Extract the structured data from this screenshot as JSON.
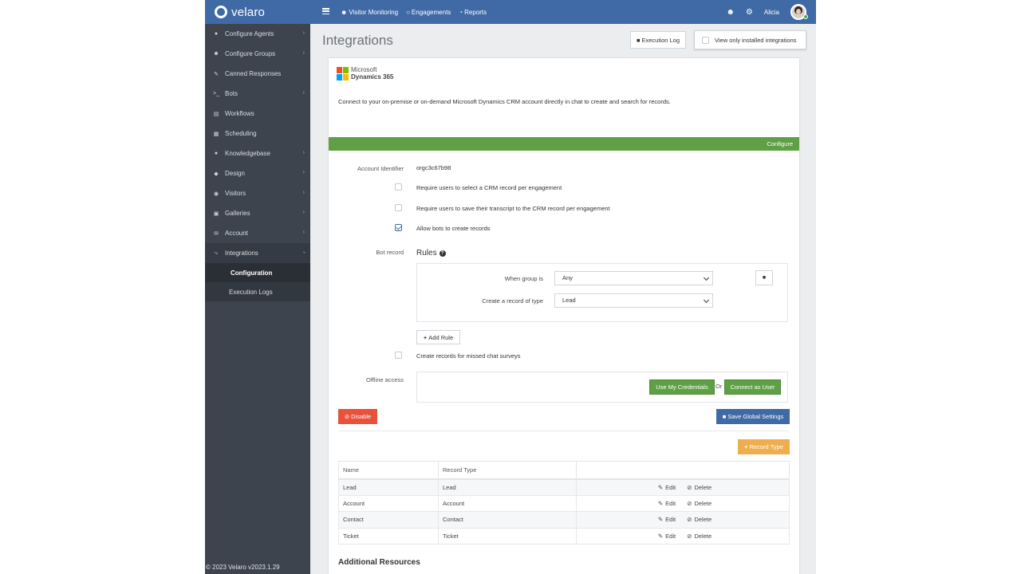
{
  "app": {
    "logo_text": "velaro"
  },
  "topnav": [
    {
      "label": "Visitor Monitoring",
      "icon": "users-icon"
    },
    {
      "label": "Engagements",
      "icon": "chat-icon"
    },
    {
      "label": "Reports",
      "icon": "pie-chart-icon"
    }
  ],
  "user": {
    "name": "Alicia"
  },
  "sidebar": {
    "items": [
      {
        "label": "Configure Agents",
        "icon": "user-icon",
        "chevron": true
      },
      {
        "label": "Configure Groups",
        "icon": "users-icon",
        "chevron": true
      },
      {
        "label": "Canned Responses",
        "icon": "edit-icon",
        "chevron": false
      },
      {
        "label": "Bots",
        "icon": "terminal-icon",
        "chevron": true
      },
      {
        "label": "Workflows",
        "icon": "keyboard-icon",
        "chevron": false
      },
      {
        "label": "Scheduling",
        "icon": "calendar-icon",
        "chevron": false
      },
      {
        "label": "Knowledgebase",
        "icon": "lightbulb-icon",
        "chevron": true
      },
      {
        "label": "Design",
        "icon": "diamond-icon",
        "chevron": true
      },
      {
        "label": "Visitors",
        "icon": "eye-icon",
        "chevron": true
      },
      {
        "label": "Galleries",
        "icon": "image-icon",
        "chevron": true
      },
      {
        "label": "Account",
        "icon": "envelope-icon",
        "chevron": true
      },
      {
        "label": "Integrations",
        "icon": "plug-icon",
        "chevron": true
      }
    ],
    "sub_items": [
      {
        "label": "Configuration"
      },
      {
        "label": "Execution Logs"
      }
    ],
    "copyright": "© 2023 Velaro   v2023.1.29"
  },
  "page": {
    "title": "Integrations",
    "execution_log_label": "Execution Log",
    "view_installed_label": "View only installed integrations"
  },
  "integration": {
    "brand_line1": "Microsoft",
    "brand_line2": "Dynamics 365",
    "description": "Connect to your on-premise or on-demand Microsoft Dynamics CRM account directly in chat to create and search for records.",
    "configure_label": "Configure",
    "account_identifier_label": "Account Identifier",
    "account_identifier_value": "orgc3c67b98",
    "opt_require_select": "Require users to select a CRM record per engagement",
    "opt_require_save": "Require users to save their transcript to the CRM record per engagement",
    "opt_allow_bots": "Allow bots to create records",
    "bot_record_label": "Bot record",
    "rules_title": "Rules",
    "rule_group_label": "When group is",
    "rule_group_value": "Any",
    "rule_type_label": "Create a record of type",
    "rule_type_value": "Lead",
    "add_rule_label": "Add Rule",
    "opt_missed_surveys": "Create records for missed chat surveys",
    "offline_label": "Offline access",
    "use_credentials_label": "Use My Credentials",
    "or_label": "Or",
    "connect_user_label": "Connect as User",
    "disable_label": "Disable",
    "save_global_label": "Save Global Settings",
    "record_type_label": "Record Type"
  },
  "table": {
    "headers": [
      "Name",
      "Record Type",
      ""
    ],
    "rows": [
      {
        "name": "Lead",
        "type": "Lead"
      },
      {
        "name": "Account",
        "type": "Account"
      },
      {
        "name": "Contact",
        "type": "Contact"
      },
      {
        "name": "Ticket",
        "type": "Ticket"
      }
    ],
    "edit_label": "Edit",
    "delete_label": "Delete"
  },
  "additional_resources": "Additional Resources",
  "colors": {
    "topbar": "#3f6aa6",
    "sidebar": "#3d444e",
    "green": "#5fa046",
    "red": "#e8513c",
    "orange": "#f0ad4e"
  }
}
